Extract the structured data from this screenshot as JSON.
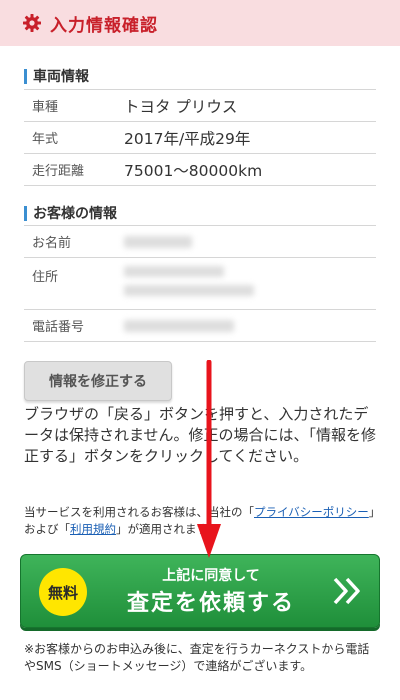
{
  "header": {
    "title": "入力情報確認",
    "icon": "gear-icon",
    "accent": "#c8202a"
  },
  "vehicle": {
    "section_title": "車両情報",
    "rows": [
      {
        "label": "車種",
        "value": "トヨタ プリウス"
      },
      {
        "label": "年式",
        "value": "2017年/平成29年"
      },
      {
        "label": "走行距離",
        "value": "75001〜80000km"
      }
    ]
  },
  "customer": {
    "section_title": "お客様の情報",
    "rows": [
      {
        "label": "お名前"
      },
      {
        "label": "住所"
      },
      {
        "label": "電話番号"
      }
    ]
  },
  "edit_button": {
    "label": "情報を修正する"
  },
  "notice": "ブラウザの「戻る」ボタンを押すと、入力されたデータは保持されません。修正の場合には、「情報を修正する」ボタンをクリックしてください。",
  "agreement": {
    "prefix": "当サービスを利用されるお客様は、当社の「",
    "privacy_link": "プライバシーポリシー",
    "middle": "」および「",
    "terms_link": "利用規約",
    "suffix": "」が適用されます。"
  },
  "cta": {
    "badge": "無料",
    "sub_label": "上記に同意して",
    "main_label": "査定を依頼する",
    "color": "#2ea04a"
  },
  "footnote": "※お客様からのお申込み後に、査定を行うカーネクストから電話やSMS（ショートメッセージ）で連絡がございます。"
}
